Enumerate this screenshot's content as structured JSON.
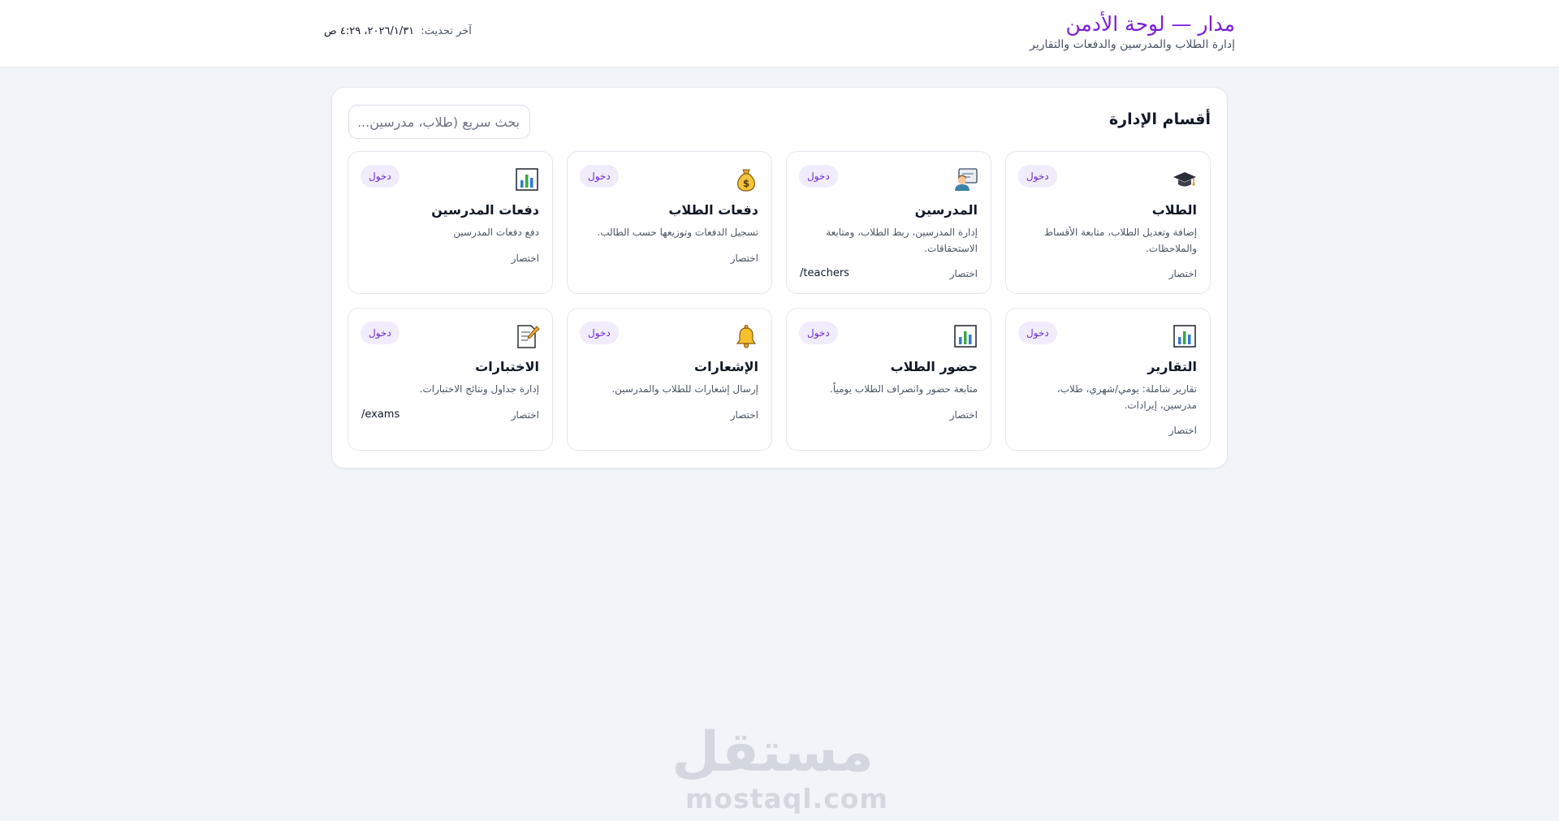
{
  "header": {
    "title": "مدار — لوحة الأدمن",
    "subtitle": "إدارة الطلاب والمدرسين والدفعات والتقارير",
    "last_update_label": "آخر تحديث:",
    "last_update_value": "٢٠٢٦/١/٣١، ٤:٢٩ ص"
  },
  "panel": {
    "title": "أقسام الإدارة",
    "search_placeholder": "بحث سريع (طلاب، مدرسين...)"
  },
  "cards": [
    {
      "title": "الطلاب",
      "desc": "إضافة وتعديل الطلاب، متابعة الأقساط والملاحظات.",
      "icon": "graduation-cap-icon",
      "enter": "دخول",
      "shortcut": "اختصار",
      "path": ""
    },
    {
      "title": "المدرسين",
      "desc": "إدارة المدرسين، ربط الطلاب، ومتابعة الاستحقاقات.",
      "icon": "teacher-icon",
      "enter": "دخول",
      "shortcut": "اختصار",
      "path": "/teachers"
    },
    {
      "title": "دفعات الطلاب",
      "desc": "تسجيل الدفعات وتوزيعها حسب الطالب.",
      "icon": "money-bag-icon",
      "enter": "دخول",
      "shortcut": "اختصار",
      "path": ""
    },
    {
      "title": "دفعات المدرسين",
      "desc": "دفع دفعات المدرسين",
      "icon": "bar-chart-icon",
      "enter": "دخول",
      "shortcut": "اختصار",
      "path": ""
    },
    {
      "title": "التقارير",
      "desc": "تقارير شاملة: يومي/شهري، طلاب، مدرسين، إيرادات.",
      "icon": "bar-chart-icon",
      "enter": "دخول",
      "shortcut": "اختصار",
      "path": ""
    },
    {
      "title": "حضور الطلاب",
      "desc": "متابعة حضور وانصراف الطلاب يومياً.",
      "icon": "bar-chart-icon",
      "enter": "دخول",
      "shortcut": "اختصار",
      "path": ""
    },
    {
      "title": "الإشعارات",
      "desc": "إرسال إشعارات للطلاب والمدرسين.",
      "icon": "bell-icon",
      "enter": "دخول",
      "shortcut": "اختصار",
      "path": ""
    },
    {
      "title": "الاختبارات",
      "desc": "إدارة جداول ونتائج الاختبارات.",
      "icon": "memo-icon",
      "enter": "دخول",
      "shortcut": "اختصار",
      "path": "/exams"
    }
  ],
  "watermark": {
    "arabic": "مستقل",
    "latin": "mostaql.com"
  }
}
